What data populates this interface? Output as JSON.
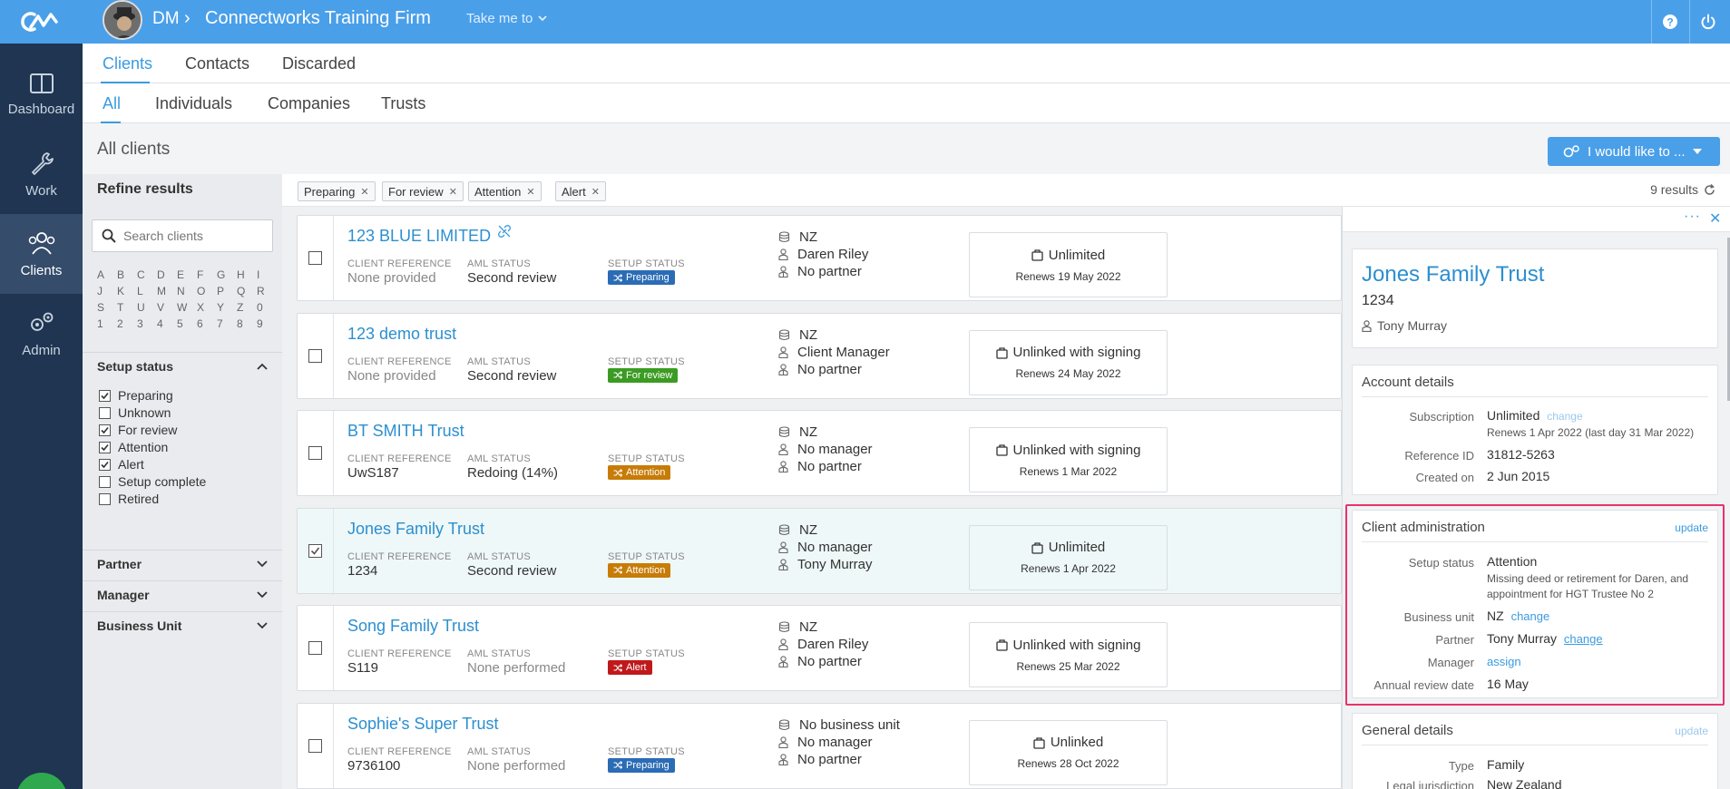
{
  "topbar": {
    "org_initials": "DM",
    "org_name": "Connectworks Training Firm",
    "take_me_to": "Take me to",
    "colors": {
      "topbar": "#4a9fe9",
      "sidebar": "#1f3551"
    }
  },
  "sidebar": {
    "items": [
      {
        "label": "Dashboard",
        "icon": "dashboard-icon"
      },
      {
        "label": "Work",
        "icon": "wrench-icon"
      },
      {
        "label": "Clients",
        "icon": "users-icon",
        "active": true
      },
      {
        "label": "Admin",
        "icon": "gears-icon"
      }
    ]
  },
  "tabs_primary": [
    "Clients",
    "Contacts",
    "Discarded"
  ],
  "tabs_secondary": [
    "All",
    "Individuals",
    "Companies",
    "Trusts"
  ],
  "page": {
    "title": "All clients",
    "action_button": "I would like to ..."
  },
  "refine": {
    "title": "Refine results",
    "search_placeholder": "Search clients",
    "alphabet": [
      "A",
      "B",
      "C",
      "D",
      "E",
      "F",
      "G",
      "H",
      "I",
      "J",
      "K",
      "L",
      "M",
      "N",
      "O",
      "P",
      "Q",
      "R",
      "S",
      "T",
      "U",
      "V",
      "W",
      "X",
      "Y",
      "Z",
      "0",
      "1",
      "2",
      "3",
      "4",
      "5",
      "6",
      "7",
      "8",
      "9"
    ],
    "setup_status_title": "Setup status",
    "setup_status_options": [
      {
        "label": "Preparing",
        "checked": true
      },
      {
        "label": "Unknown",
        "checked": false
      },
      {
        "label": "For review",
        "checked": true
      },
      {
        "label": "Attention",
        "checked": true
      },
      {
        "label": "Alert",
        "checked": true
      },
      {
        "label": "Setup complete",
        "checked": false
      },
      {
        "label": "Retired",
        "checked": false
      }
    ],
    "partner_title": "Partner",
    "manager_title": "Manager",
    "business_unit_title": "Business Unit"
  },
  "chips": [
    "Preparing",
    "For review",
    "Attention",
    "Alert"
  ],
  "results_count": "9 results",
  "labels": {
    "client_reference": "CLIENT REFERENCE",
    "aml_status": "AML STATUS",
    "setup_status": "SETUP STATUS"
  },
  "status_colors": {
    "Preparing": "#2b6cb5",
    "For review": "#3b9b22",
    "Attention": "#c77c08",
    "Alert": "#c0191b"
  },
  "clients": [
    {
      "name": "123 BLUE LIMITED",
      "ref": "None provided",
      "ref_muted": true,
      "aml": "Second review",
      "aml_muted": false,
      "status": "Preparing",
      "unit": "NZ",
      "manager": "Daren Riley",
      "partner": "No partner",
      "subscription": "Unlimited",
      "renews": "Renews 19 May 2022",
      "link_icon": true,
      "checked": false
    },
    {
      "name": "123 demo trust",
      "ref": "None provided",
      "ref_muted": true,
      "aml": "Second review",
      "aml_muted": false,
      "status": "For review",
      "unit": "NZ",
      "manager": "Client Manager",
      "partner": "No partner",
      "subscription": "Unlinked with signing",
      "renews": "Renews 24 May 2022",
      "link_icon": false,
      "checked": false
    },
    {
      "name": "BT SMITH Trust",
      "ref": "UwS187",
      "ref_muted": false,
      "aml": "Redoing (14%)",
      "aml_muted": false,
      "status": "Attention",
      "unit": "NZ",
      "manager": "No manager",
      "partner": "No partner",
      "subscription": "Unlinked with signing",
      "renews": "Renews 1 Mar 2022",
      "link_icon": false,
      "checked": false
    },
    {
      "name": "Jones Family Trust",
      "ref": "1234",
      "ref_muted": false,
      "aml": "Second review",
      "aml_muted": false,
      "status": "Attention",
      "unit": "NZ",
      "manager": "No manager",
      "partner": "Tony Murray",
      "subscription": "Unlimited",
      "renews": "Renews 1 Apr 2022",
      "link_icon": false,
      "checked": true
    },
    {
      "name": "Song Family Trust",
      "ref": "S119",
      "ref_muted": false,
      "aml": "None performed",
      "aml_muted": true,
      "status": "Alert",
      "unit": "NZ",
      "manager": "Daren Riley",
      "partner": "No partner",
      "subscription": "Unlinked with signing",
      "renews": "Renews 25 Mar 2022",
      "link_icon": false,
      "checked": false
    },
    {
      "name": "Sophie's Super Trust",
      "ref": "9736100",
      "ref_muted": false,
      "aml": "None performed",
      "aml_muted": true,
      "status": "Preparing",
      "unit": "No business unit",
      "manager": "No manager",
      "partner": "No partner",
      "subscription": "Unlinked",
      "renews": "Renews 28 Oct 2022",
      "link_icon": false,
      "checked": false
    }
  ],
  "detail": {
    "name": "Jones Family Trust",
    "ref": "1234",
    "person": "Tony Murray",
    "account": {
      "title": "Account details",
      "subscription_label": "Subscription",
      "subscription_value": "Unlimited",
      "subscription_link": "change",
      "subscription_sub": "Renews 1 Apr 2022 (last day 31 Mar 2022)",
      "refid_label": "Reference ID",
      "refid_value": "31812-5263",
      "created_label": "Created on",
      "created_value": "2 Jun 2015"
    },
    "admin": {
      "title": "Client administration",
      "update": "update",
      "setup_label": "Setup status",
      "setup_value": "Attention",
      "setup_note": "Missing deed or retirement for Daren, and appointment for HGT Trustee No 2",
      "bu_label": "Business unit",
      "bu_value": "NZ",
      "bu_link": "change",
      "partner_label": "Partner",
      "partner_value": "Tony Murray",
      "partner_link": "change",
      "manager_label": "Manager",
      "manager_link": "assign",
      "review_label": "Annual review date",
      "review_value": "16 May"
    },
    "general": {
      "title": "General details",
      "update": "update",
      "type_label": "Type",
      "type_value": "Family",
      "jurisdiction_label": "Legal jurisdiction",
      "jurisdiction_value": "New Zealand"
    }
  }
}
